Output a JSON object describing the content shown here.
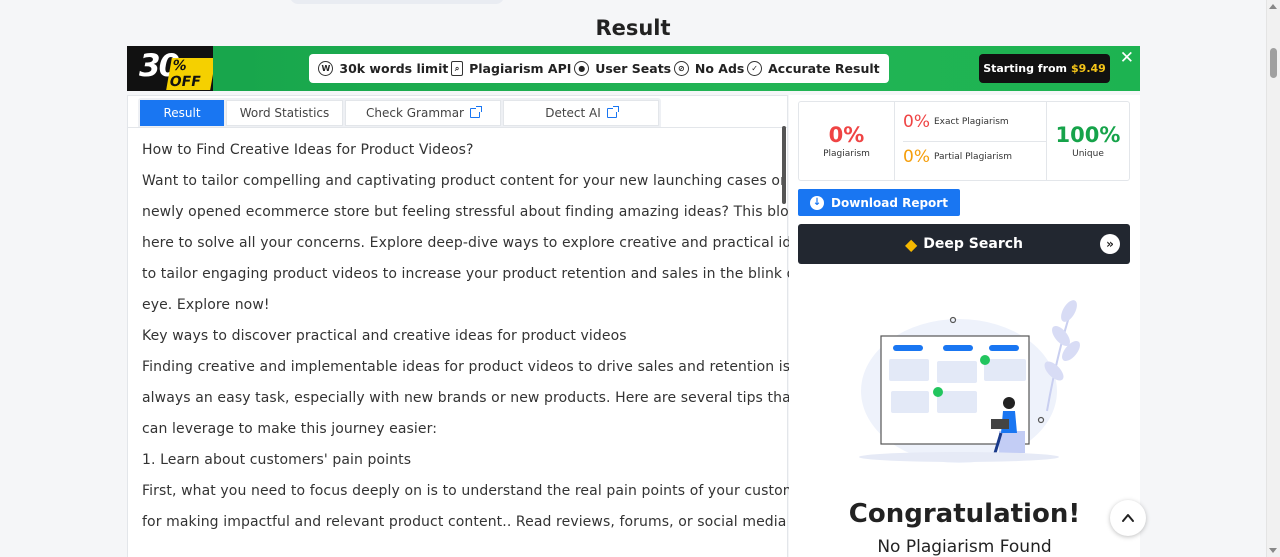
{
  "page": {
    "title": "Result"
  },
  "banner": {
    "promo_number": "30",
    "promo_text": "% OFF",
    "features": [
      {
        "icon": "words-icon",
        "label": "30k words limit"
      },
      {
        "icon": "document-search-icon",
        "label": "Plagiarism API"
      },
      {
        "icon": "user-icon",
        "label": "User Seats"
      },
      {
        "icon": "no-ads-icon",
        "label": "No Ads"
      },
      {
        "icon": "check-circle-icon",
        "label": "Accurate Result"
      }
    ],
    "cta_label": "Starting from",
    "cta_price": "$9.49",
    "close": "✕"
  },
  "tabs": [
    {
      "label": "Result",
      "active": true
    },
    {
      "label": "Word Statistics",
      "active": false
    },
    {
      "label": "Check Grammar",
      "active": false,
      "external": true
    },
    {
      "label": "Detect AI",
      "active": false,
      "external": true
    }
  ],
  "text_lines": [
    "How to Find Creative Ideas for Product Videos?",
    "Want to tailor compelling and captivating product content for your new launching cases or",
    "newly opened ecommerce store but feeling stressful about finding amazing ideas? This blog is",
    "here to solve all your concerns. Explore deep-dive ways to explore creative and practical ideas",
    "to tailor engaging product videos to increase your product retention and sales in the blink of an",
    "eye. Explore now!",
    "Key ways to discover practical and creative ideas for product videos",
    "Finding creative and implementable ideas for product videos to drive sales and retention is not",
    "always an easy task, especially with new brands or new products. Here are several tips that you",
    "can leverage to make this journey easier:",
    "1. Learn about customers' pain points",
    "First, what you need to focus deeply on is to understand the real pain points of your customers",
    "for making impactful and relevant product content.. Read reviews, forums, or social media to"
  ],
  "stats": {
    "plagiarism_value": "0%",
    "plagiarism_label": "Plagiarism",
    "exact_value": "0%",
    "exact_label": "Exact Plagiarism",
    "partial_value": "0%",
    "partial_label": "Partial Plagiarism",
    "unique_value": "100%",
    "unique_label": "Unique"
  },
  "actions": {
    "download_label": "Download Report",
    "deep_search_label": "Deep Search"
  },
  "result": {
    "heading": "Congratulation!",
    "subheading": "No Plagiarism Found"
  },
  "colors": {
    "accent_blue": "#1976f2",
    "banner_green": "#22b455",
    "danger_red": "#ef4444",
    "warning_orange": "#f59e0b",
    "success_green": "#16a34a",
    "dark_button": "#222730"
  }
}
